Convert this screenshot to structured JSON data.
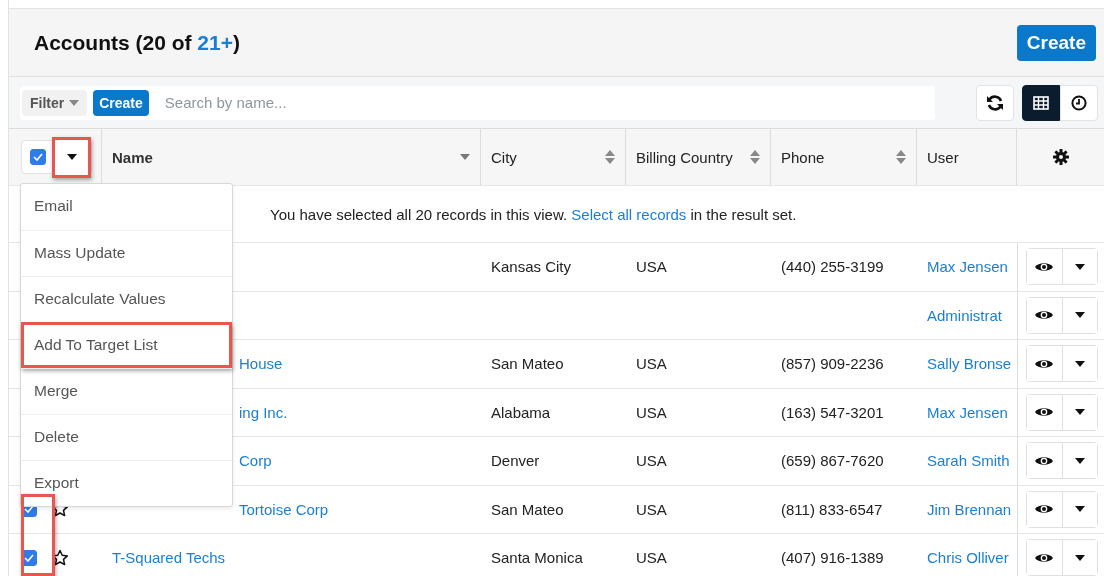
{
  "header": {
    "title": "Accounts (20 of",
    "count_link": "21+",
    "title_end": ")",
    "create_button": "Create"
  },
  "toolbar": {
    "filter_button": "Filter",
    "create_button": "Create",
    "search": {
      "placeholder": "Search by name..."
    },
    "views": [
      {
        "kind": "list",
        "selected": true
      },
      {
        "kind": "activity",
        "selected": false
      }
    ]
  },
  "bulk": {
    "checked": true,
    "highlighted": true
  },
  "columns": [
    {
      "label": "Name",
      "sortable": true,
      "sorted": true
    },
    {
      "label": "City",
      "sortable": true,
      "sorted": false
    },
    {
      "label": "Billing Country",
      "sortable": true,
      "sorted": false
    },
    {
      "label": "Phone",
      "sortable": true,
      "sorted": false
    },
    {
      "label": "User",
      "sortable": false
    }
  ],
  "notice": {
    "text": "You have selected all 20 records in this view.",
    "link": "Select all records",
    "text_end": "in the result set."
  },
  "menu": [
    {
      "label": "Email",
      "highlighted": false
    },
    {
      "label": "Mass Update",
      "highlighted": false
    },
    {
      "label": "Recalculate Values",
      "highlighted": false
    },
    {
      "label": "Add To Target List",
      "highlighted": true
    },
    {
      "label": "Merge",
      "highlighted": false
    },
    {
      "label": "Delete",
      "highlighted": false
    },
    {
      "label": "Export",
      "highlighted": false
    }
  ],
  "rows": [
    {
      "city": "Kansas City",
      "country": "USA",
      "phone": "(440) 255-3199",
      "user": "Max Jensen",
      "highlighted": false
    },
    {
      "user": "Administrat",
      "highlighted": false
    },
    {
      "name": "House",
      "city": "San Mateo",
      "country": "USA",
      "phone": "(857) 909-2236",
      "user": "Sally Bronse",
      "highlighted": false
    },
    {
      "name": "ing Inc.",
      "city": "Alabama",
      "country": "USA",
      "phone": "(163) 547-3201",
      "user": "Max Jensen",
      "highlighted": false
    },
    {
      "name": "Corp",
      "city": "Denver",
      "country": "USA",
      "phone": "(659) 867-7620",
      "user": "Sarah Smith",
      "highlighted": false
    },
    {
      "checked": true,
      "starred": false,
      "name": "Tortoise Corp",
      "city": "San Mateo",
      "country": "USA",
      "phone": "(811) 833-6547",
      "user": "Jim Brennan",
      "highlighted": true
    },
    {
      "checked": true,
      "starred": false,
      "name": "T-Squared Techs",
      "city": "Santa Monica",
      "country": "USA",
      "phone": "(407) 916-1389",
      "user": "Chris Olliver",
      "highlighted": true
    }
  ]
}
